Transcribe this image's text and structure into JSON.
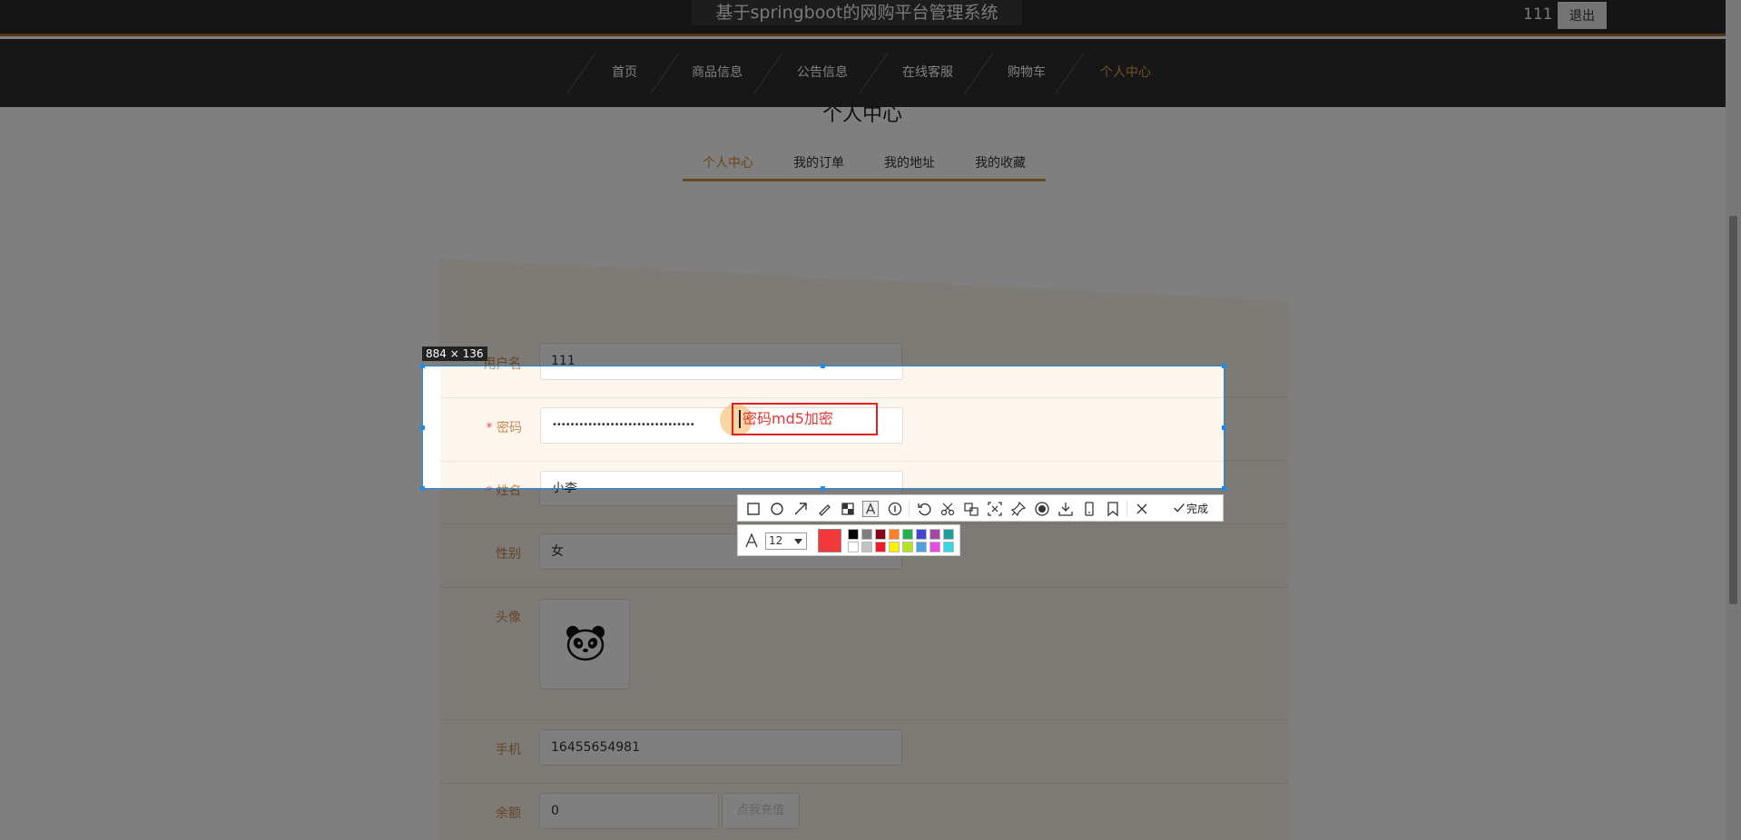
{
  "header": {
    "site_title": "基于springboot的网购平台管理系统",
    "username": "111",
    "logout_label": "退出"
  },
  "nav": {
    "items": [
      {
        "label": "首页"
      },
      {
        "label": "商品信息"
      },
      {
        "label": "公告信息"
      },
      {
        "label": "在线客服"
      },
      {
        "label": "购物车"
      },
      {
        "label": "个人中心",
        "active": true
      }
    ]
  },
  "page": {
    "section_title": "个人中心",
    "tabs": [
      {
        "label": "个人中心",
        "active": true
      },
      {
        "label": "我的订单"
      },
      {
        "label": "我的地址"
      },
      {
        "label": "我的收藏"
      }
    ]
  },
  "form": {
    "username": {
      "label": "用户名",
      "value": "111"
    },
    "password": {
      "label": "密码",
      "required_mark": "*",
      "value": "••••••••••••••••••••••••••••••••"
    },
    "name": {
      "label": "姓名",
      "required_mark": "*",
      "value": "小李"
    },
    "gender": {
      "label": "性别",
      "value": "女"
    },
    "avatar": {
      "label": "头像"
    },
    "phone": {
      "label": "手机",
      "value": "16455654981"
    },
    "balance": {
      "label": "余额",
      "value": "0",
      "recharge_label": "点我充值"
    }
  },
  "screenshot_tool": {
    "size_label": "884 × 136",
    "annotation_text": "密码md5加密",
    "font_size": "12",
    "done_label": "完成",
    "current_color": "#f23a3a",
    "palette": [
      "#000000",
      "#7f7f7f",
      "#880015",
      "#ff7f27",
      "#22b14c",
      "#3f48cc",
      "#a349a4",
      "#1f9e9e",
      "#ffffff",
      "#c3c3c3",
      "#ed1c24",
      "#fff200",
      "#b5e61d",
      "#4aa3df",
      "#e84ce8",
      "#34d8e0"
    ],
    "tools": [
      "rectangle-icon",
      "ellipse-icon",
      "arrow-icon",
      "pen-icon",
      "mosaic-icon",
      "text-icon",
      "number-icon",
      "undo-icon",
      "cut-icon",
      "translate-icon",
      "ocr-icon",
      "pin-icon",
      "record-icon",
      "download-icon",
      "save-icon",
      "bookmark-icon",
      "close-icon"
    ]
  },
  "colors": {
    "accent": "#e0a14e",
    "selection_border": "#1e8ce6",
    "annotation_red": "#e02020"
  }
}
